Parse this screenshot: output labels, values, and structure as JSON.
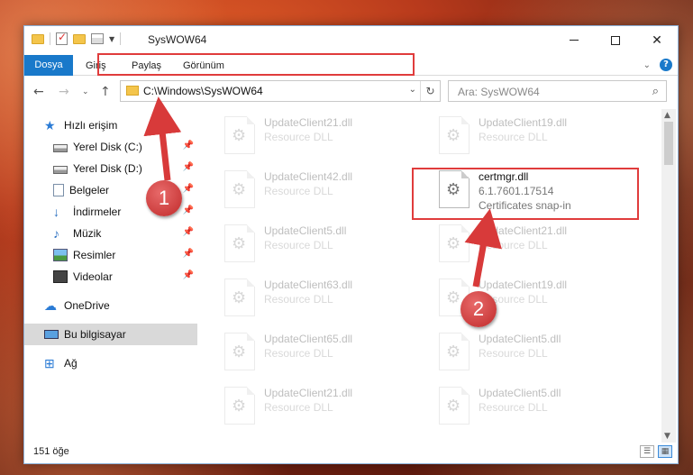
{
  "window": {
    "title": "SysWOW64",
    "controls": {
      "minimize": "—",
      "maximize": "",
      "close": "✕"
    }
  },
  "ribbon": {
    "tabs": [
      "Dosya",
      "Giriş",
      "Paylaş",
      "Görünüm"
    ]
  },
  "address": {
    "path": "C:\\Windows\\SysWOW64",
    "search_placeholder": "Ara: SysWOW64"
  },
  "sidebar": {
    "items": [
      {
        "label": "Hızlı erişim",
        "icon": "star-icon"
      },
      {
        "label": "Yerel Disk (C:)",
        "icon": "disk-icon",
        "pinned": true
      },
      {
        "label": "Yerel Disk (D:)",
        "icon": "disk-icon",
        "pinned": true
      },
      {
        "label": "Belgeler",
        "icon": "documents-icon",
        "pinned": true
      },
      {
        "label": "İndirmeler",
        "icon": "downloads-icon",
        "pinned": true
      },
      {
        "label": "Müzik",
        "icon": "music-icon",
        "pinned": true
      },
      {
        "label": "Resimler",
        "icon": "pictures-icon",
        "pinned": true
      },
      {
        "label": "Videolar",
        "icon": "videos-icon",
        "pinned": true
      },
      {
        "label": "OneDrive",
        "icon": "onedrive-icon"
      },
      {
        "label": "Bu bilgisayar",
        "icon": "this-pc-icon",
        "selected": true
      },
      {
        "label": "Ağ",
        "icon": "network-icon"
      }
    ]
  },
  "files": [
    {
      "name": "UpdateClient21.dll",
      "sub": "Resource DLL"
    },
    {
      "name": "UpdateClient19.dll",
      "sub": "Resource DLL"
    },
    {
      "name": "UpdateClient42.dll",
      "sub": "Resource DLL"
    },
    {
      "name": "certmgr.dll",
      "sub": "6.1.7601.17514",
      "sub2": "Certificates snap-in"
    },
    {
      "name": "UpdateClient5.dll",
      "sub": "Resource DLL"
    },
    {
      "name": "UpdateClient21.dll",
      "sub": "Resource DLL"
    },
    {
      "name": "UpdateClient63.dll",
      "sub": "Resource DLL"
    },
    {
      "name": "UpdateClient19.dll",
      "sub": "Resource DLL"
    },
    {
      "name": "UpdateClient65.dll",
      "sub": "Resource DLL"
    },
    {
      "name": "UpdateClient5.dll",
      "sub": "Resource DLL"
    },
    {
      "name": "UpdateClient21.dll",
      "sub": "Resource DLL"
    },
    {
      "name": "UpdateClient5.dll",
      "sub": "Resource DLL"
    }
  ],
  "status": {
    "count": "151 öğe"
  },
  "annotations": {
    "step1": "1",
    "step2": "2"
  },
  "colors": {
    "accent": "#1979ca",
    "highlight": "#e03c3c"
  }
}
